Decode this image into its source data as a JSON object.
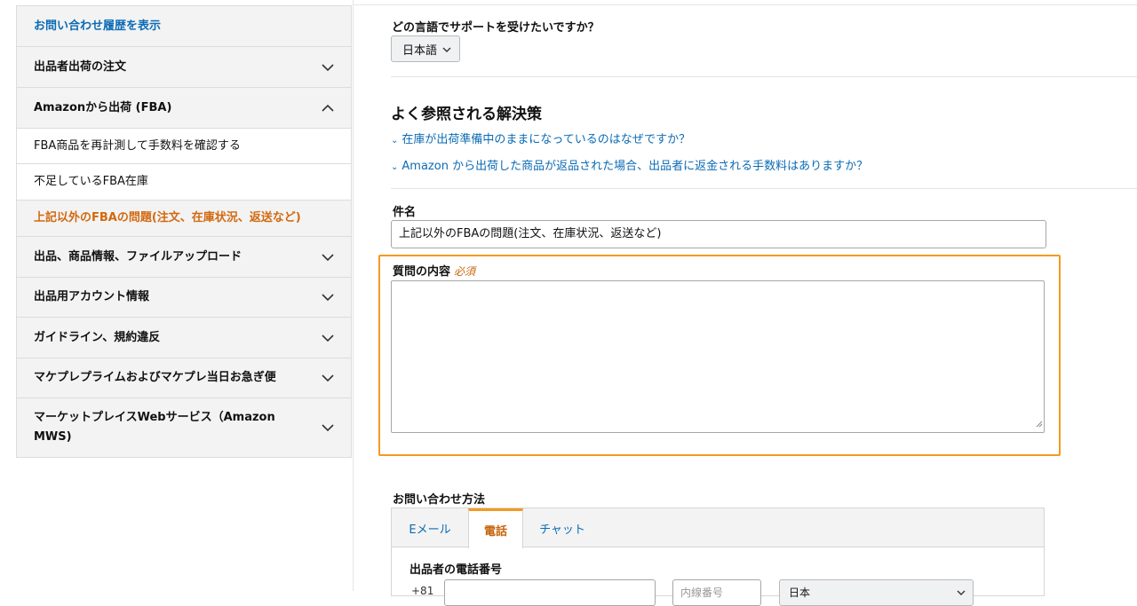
{
  "sidebar": {
    "history_link": "お問い合わせ履歴を表示",
    "items": [
      {
        "label": "出品者出荷の注文",
        "icon": "chevron-down-icon"
      },
      {
        "label": "Amazonから出荷 (FBA)",
        "icon": "chevron-up-icon"
      },
      {
        "label": "FBA商品を再計測して手数料を確認する"
      },
      {
        "label": "不足しているFBA在庫"
      },
      {
        "label": "上記以外のFBAの問題(注文、在庫状況、返送など)"
      },
      {
        "label": "出品、商品情報、ファイルアップロード",
        "icon": "chevron-down-icon"
      },
      {
        "label": "出品用アカウント情報",
        "icon": "chevron-down-icon"
      },
      {
        "label": "ガイドライン、規約違反",
        "icon": "chevron-down-icon"
      },
      {
        "label": "マケプレプライムおよびマケプレ当日お急ぎ便",
        "icon": "chevron-down-icon"
      },
      {
        "label_line1": "マーケットプレイスWebサービス（Amazon",
        "label_line2": "MWS)",
        "icon": "chevron-down-icon"
      }
    ]
  },
  "main": {
    "language_question": "どの言語でサポートを受けたいですか？",
    "language_selected": "日本語",
    "faq_title": "よく参照される解決策",
    "faq_links": [
      "在庫が出荷準備中のままになっているのはなぜですか？",
      "Amazon から出荷した商品が返品された場合、出品者に返金される手数料はありますか？"
    ],
    "subject_label": "件名",
    "subject_value": "上記以外のFBAの問題(注文、在庫状況、返送など)",
    "content_label": "質問の内容",
    "required_label": "必須",
    "contact_method_label": "お問い合わせ方法",
    "tabs": [
      "Eメール",
      "電話",
      "チャット"
    ],
    "active_tab": "電話",
    "phone_label": "出品者の電話番号",
    "country_code": "+81",
    "extension_placeholder": "内線番号",
    "country_selected": "日本"
  },
  "colors": {
    "link": "#0b6bb5",
    "accent_orange": "#f39a24",
    "active_text": "#c7650b"
  }
}
